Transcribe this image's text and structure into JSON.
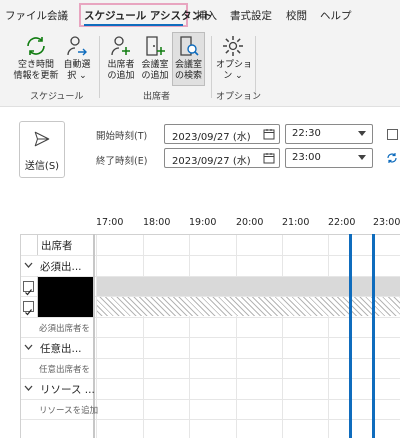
{
  "menubar": {
    "items": [
      "ファイル",
      "会議",
      "スケジュール アシスタント",
      "挿入",
      "書式設定",
      "校閲",
      "ヘルプ"
    ]
  },
  "ribbon": {
    "free_busy": [
      "空き時間",
      "情報を更新"
    ],
    "autopick": [
      "自動選",
      "択 ⌄"
    ],
    "add_attendee": [
      "出席者",
      "の追加"
    ],
    "add_room": [
      "会議室",
      "の追加"
    ],
    "room_finder": [
      "会議室",
      "の検索"
    ],
    "options": [
      "オプショ",
      "ン ⌄"
    ],
    "group_schedule": "スケジュール",
    "group_attendees": "出席者",
    "group_options": "オプション"
  },
  "send": {
    "label": "送信(S)"
  },
  "start": {
    "label": "開始時刻(T)",
    "date": "2023/09/27 (水)",
    "time": "22:30"
  },
  "end": {
    "label": "終了時刻(E)",
    "date": "2023/09/27 (水)",
    "time": "23:00"
  },
  "timeline": {
    "ticks": [
      "17:00",
      "18:00",
      "19:00",
      "20:00",
      "21:00",
      "22:00",
      "23:00"
    ]
  },
  "attendees": {
    "header": "出席者",
    "required_group": "必須出...",
    "required_add": "必須出席者を",
    "optional_group": "任意出...",
    "optional_add": "任意出席者を",
    "resource_group": "リソース ...",
    "resource_add": "リソースを追加"
  },
  "colors": {
    "accent": "#0f6cbd",
    "highlight": "#e8a5c0",
    "green": "#107c10"
  }
}
